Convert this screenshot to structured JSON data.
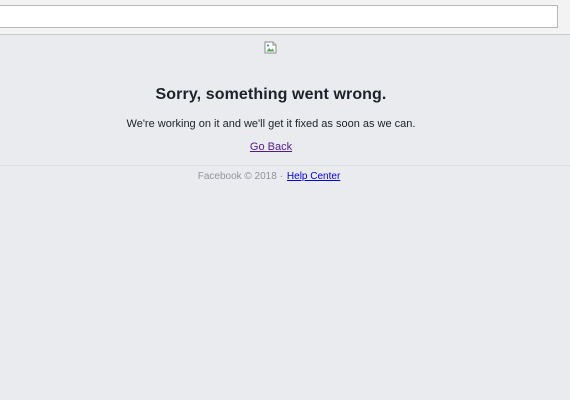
{
  "error": {
    "title": "Sorry, something went wrong.",
    "message": "We're working on it and we'll get it fixed as soon as we can.",
    "go_back_label": "Go Back"
  },
  "footer": {
    "copyright": "Facebook © 2018 ·",
    "help_center_label": "Help Center"
  },
  "icons": {
    "broken_image": "broken-image-icon"
  },
  "colors": {
    "background": "#e9ebee",
    "title_text": "#1d2129",
    "visited_link": "#551a8b",
    "link": "#0000ee",
    "footer_text": "#90949c"
  }
}
